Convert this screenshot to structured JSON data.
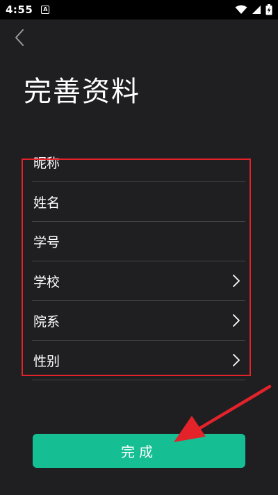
{
  "status_bar": {
    "time": "4:55",
    "notification_glyph": "A",
    "icons": [
      "wifi-icon",
      "signal-icon",
      "battery-charging-icon"
    ]
  },
  "header": {
    "back_icon": "chevron-left-icon",
    "title": "完善资料"
  },
  "form": {
    "rows": [
      {
        "label": "昵称",
        "has_chevron": false
      },
      {
        "label": "姓名",
        "has_chevron": false
      },
      {
        "label": "学号",
        "has_chevron": false
      },
      {
        "label": "学校",
        "has_chevron": true
      },
      {
        "label": "院系",
        "has_chevron": true
      },
      {
        "label": "性别",
        "has_chevron": true
      }
    ]
  },
  "footer": {
    "done_label": "完成"
  },
  "colors": {
    "background": "#1f1f22",
    "accent": "#16bf93",
    "annotation": "#e3222a",
    "divider": "#45454a"
  }
}
